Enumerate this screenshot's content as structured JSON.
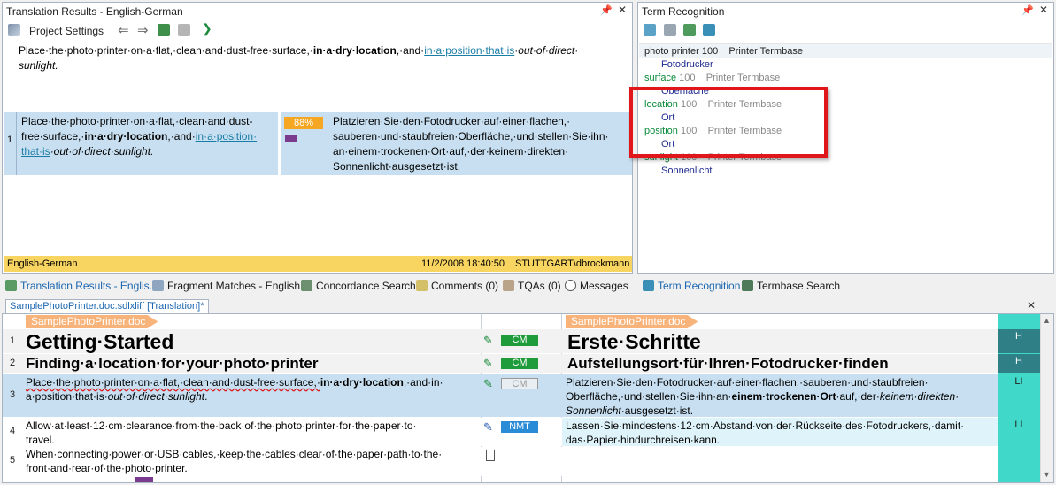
{
  "translation_results": {
    "title": "Translation Results - English-German",
    "toolbar": {
      "project_settings": "Project Settings"
    },
    "source_preview": "Place·the·photo·printer·on·a·flat,·clean·and·dust-free·surface,·",
    "source_preview_bold": "in·a·dry·location",
    "source_preview_mid": ",·and·",
    "source_preview_link": "in·a·position·that·is",
    "source_preview_end": "·out·of·direct·",
    "source_preview_line2": "sunlight.",
    "match": {
      "row": "1",
      "source_a": "Place·the·photo·printer·on·a·flat,·clean·and·dust-",
      "source_b": "free·surface,·",
      "source_b_bold": "in·a·dry·location",
      "source_b_mid": ",·and·",
      "source_b_link": "in·a·position·",
      "source_c_link": "that·is",
      "source_c_end": "·out·of·direct·sunlight.",
      "score": "88%",
      "target_a": "Platzieren·Sie·den·Fotodrucker·auf·einer·flachen,·",
      "target_b": "sauberen·und·staubfreien·Oberfläche,·und·stellen·Sie·ihn·",
      "target_c": "an·einem·trockenen·Ort·auf,·der·keinem·direkten·",
      "target_d": "Sonnenlicht·ausgesetzt·ist."
    },
    "footer": {
      "lang": "English-German",
      "date": "11/2/2008 18:40:50",
      "user": "STUTTGART\\dbrockmann"
    }
  },
  "term_recognition": {
    "title": "Term Recognition",
    "terms": [
      {
        "term": "photo printer",
        "score": "100",
        "base": "Printer Termbase",
        "translation": "Fotodrucker"
      },
      {
        "term": "surface",
        "score": "100",
        "base": "Printer Termbase",
        "translation": "Oberfläche"
      },
      {
        "term": "location",
        "score": "100",
        "base": "Printer Termbase",
        "translation": "Ort"
      },
      {
        "term": "position",
        "score": "100",
        "base": "Printer Termbase",
        "translation": "Ort"
      },
      {
        "term": "sunlight",
        "score": "100",
        "base": "Printer Termbase",
        "translation": "Sonnenlicht"
      }
    ]
  },
  "bottom_tabs_left": [
    {
      "label": "Translation Results - Englis..."
    },
    {
      "label": "Fragment Matches - English..."
    },
    {
      "label": "Concordance Search"
    },
    {
      "label": "Comments (0)"
    },
    {
      "label": "TQAs (0)"
    },
    {
      "label": "Messages"
    }
  ],
  "bottom_tabs_right": [
    {
      "label": "Term Recognition"
    },
    {
      "label": "Termbase Search"
    }
  ],
  "editor": {
    "doc_tab": "SamplePhotoPrinter.doc.sdlxliff [Translation]*",
    "file_label_src": "SamplePhotoPrinter.doc",
    "file_label_tgt": "SamplePhotoPrinter.doc",
    "rows": [
      {
        "num": "1",
        "source": "Getting·Started",
        "status": "CM",
        "target": "Erste·Schritte",
        "tag": "H"
      },
      {
        "num": "2",
        "source": "Finding·a·location·for·your·photo·printer",
        "status": "CM",
        "target": "Aufstellungsort·für·Ihren·Fotodrucker·finden",
        "tag": "H"
      },
      {
        "num": "3",
        "status": "CM",
        "tag": "LI",
        "src1": "Place·the·photo·printer·on·a·flat,·clean·and·dust-free·surface,·",
        "src1b": "in·a·dry·location",
        "src1c": ",·and·in·",
        "src2": "a·position·that·is·",
        "src2i": "out·of·direct·sunlight",
        "src2e": ".",
        "tgt1": "Platzieren·Sie·den·Fotodrucker·auf·einer·flachen,·sauberen·und·staubfreien·",
        "tgt2": "Oberfläche,·und·stellen·Sie·ihn·an·",
        "tgt2b": "einem·trockenen·Ort",
        "tgt2c": "·auf,·der·",
        "tgt2i": "keinem·direkten·",
        "tgt3i": "Sonnenlicht",
        "tgt3": "·ausgesetzt·ist."
      },
      {
        "num": "4",
        "status": "NMT",
        "tag": "LI",
        "src1": "Allow·at·least·12·cm·clearance·from·the·back·of·the·photo·printer·for·the·paper·to·",
        "src2": "travel.",
        "tgt1": "Lassen·Sie·mindestens·12·cm·Abstand·von·der·Rückseite·des·Fotodruckers,·damit·",
        "tgt2": "das·Papier·hindurchreisen·kann."
      },
      {
        "num": "5",
        "src1": "When·connecting·power·or·USB·cables,·keep·the·cables·clear·of·the·paper·path·to·the·",
        "src2": "front·and·rear·of·the·photo·printer."
      }
    ]
  },
  "colors": {
    "cm_green": "#1e9b3b",
    "nmt_blue": "#2a8bd6",
    "highlight_red": "#e0161b",
    "tag_teal": "#40d8c8",
    "selected_row": "#c7dff0"
  }
}
